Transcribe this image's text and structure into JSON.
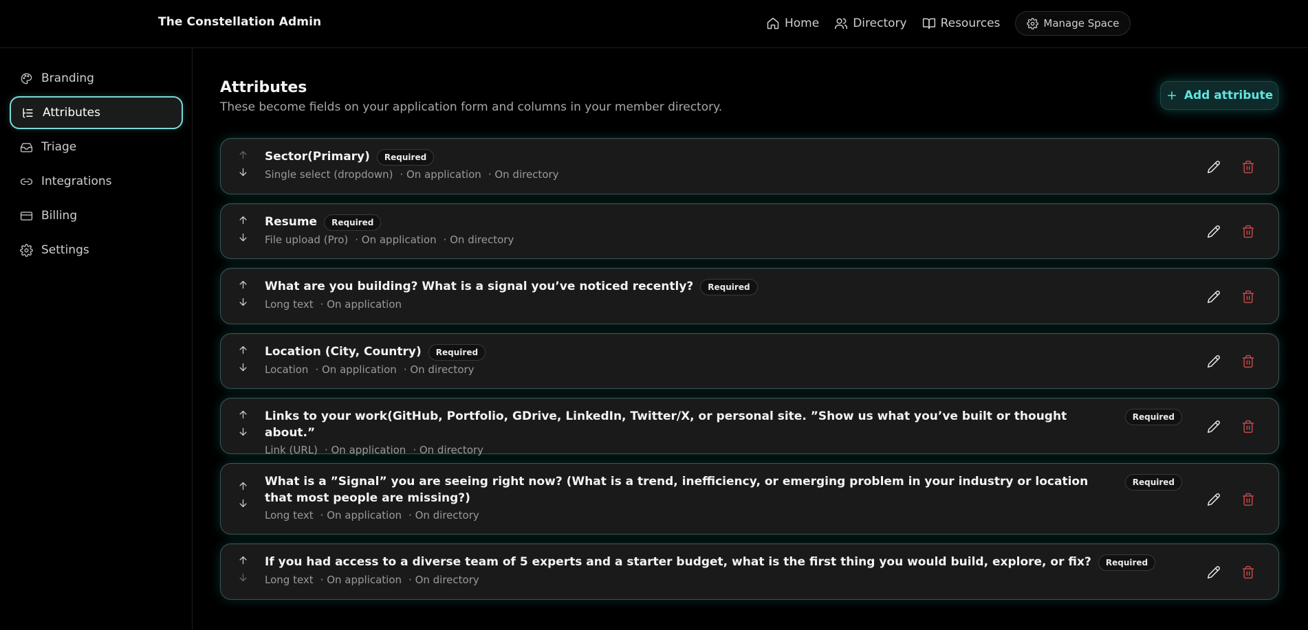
{
  "header": {
    "brand": "The Constellation Admin",
    "nav": [
      {
        "label": "Home",
        "icon": "home-icon"
      },
      {
        "label": "Directory",
        "icon": "users-icon"
      },
      {
        "label": "Resources",
        "icon": "book-icon"
      }
    ],
    "manage_space": "Manage Space"
  },
  "sidebar": {
    "items": [
      {
        "label": "Branding",
        "icon": "palette-icon"
      },
      {
        "label": "Attributes",
        "icon": "list-icon",
        "active": true
      },
      {
        "label": "Triage",
        "icon": "inbox-icon"
      },
      {
        "label": "Integrations",
        "icon": "link-icon"
      },
      {
        "label": "Billing",
        "icon": "card-icon"
      },
      {
        "label": "Settings",
        "icon": "gear-icon"
      }
    ]
  },
  "main": {
    "title": "Attributes",
    "subtitle": "These become fields on your application form and columns in your member directory.",
    "add_button": "Add attribute"
  },
  "attributes": [
    {
      "title": "Sector(Primary)",
      "badge": "Required",
      "meta": [
        "Single select (dropdown)",
        "· On application",
        "· On directory"
      ]
    },
    {
      "title": "Resume",
      "badge": "Required",
      "meta": [
        "File upload (Pro)",
        "· On application",
        "· On directory"
      ]
    },
    {
      "title": "What are you building? What is a signal you’ve noticed recently?",
      "badge": "Required",
      "meta": [
        "Long text",
        "· On application"
      ]
    },
    {
      "title": "Location (City, Country)",
      "badge": "Required",
      "meta": [
        "Location",
        "· On application",
        "· On directory"
      ]
    },
    {
      "title": "Links to your work(GitHub, Portfolio, GDrive, LinkedIn, Twitter/X, or personal site. ”Show us what you’ve built or thought about.”",
      "badge": "Required",
      "meta": [
        "Link (URL)",
        "· On application",
        "· On directory"
      ]
    },
    {
      "title": "What is a ”Signal” you are seeing right now? (What is a trend, inefficiency, or emerging problem in your industry or location that most people are missing?)",
      "badge": "Required",
      "meta": [
        "Long text",
        "· On application",
        "· On directory"
      ]
    },
    {
      "title": "If you had access to a diverse team of 5 experts and a starter budget, what is the first thing you would build, explore, or fix?",
      "badge": "Required",
      "meta": [
        "Long text",
        "· On application",
        "· On directory"
      ]
    }
  ],
  "colors": {
    "accent": "#5ee6e0",
    "active_border": "#7fd9d6",
    "danger": "#c0494c"
  }
}
